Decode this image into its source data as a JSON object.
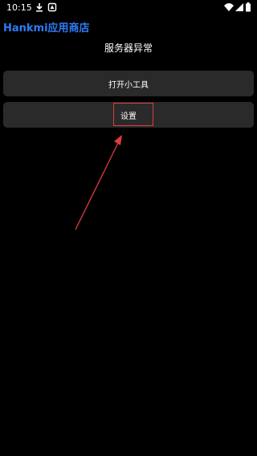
{
  "status_bar": {
    "time": "10:15",
    "icons": [
      "download-icon",
      "app-notification-icon",
      "wifi-icon",
      "signal-icon",
      "battery-icon"
    ]
  },
  "app": {
    "title": "Hankmi应用商店",
    "server_status": "服务器异常"
  },
  "buttons": {
    "open_tool": "打开小工具",
    "settings": "设置"
  },
  "colors": {
    "background": "#000000",
    "title": "#2f7cf6",
    "button_bg": "#2a2a2a",
    "annotation": "#e23b3b"
  }
}
